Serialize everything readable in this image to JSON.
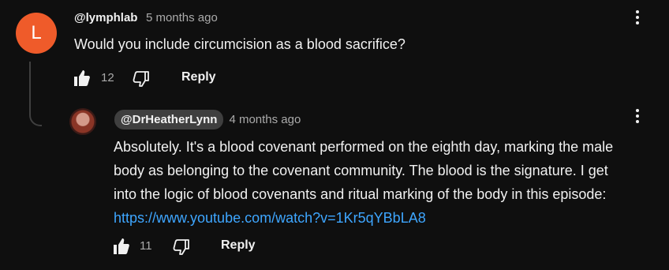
{
  "comment": {
    "avatar_letter": "L",
    "avatar_color": "#ef5b2a",
    "handle": "@lymphlab",
    "time": "5 months ago",
    "text": "Would you include circumcision as a blood sacrifice?",
    "likes": "12",
    "reply_label": "Reply"
  },
  "reply": {
    "handle": "@DrHeatherLynn",
    "time": "4 months ago",
    "lines": [
      "Absolutely. It's a blood covenant performed on the eighth day, marking the male",
      "body as belonging to the covenant community. The blood is the signature. I get",
      "into the logic of blood covenants and ritual marking of the body in this episode:"
    ],
    "link": "https://www.youtube.com/watch?v=1Kr5qYBbLA8",
    "likes": "11",
    "reply_label": "Reply"
  },
  "colors": {
    "background": "#0f0f0f",
    "link": "#3ea6ff",
    "muted": "#aaaaaa"
  },
  "icons": [
    "thumbs-up-icon",
    "thumbs-down-icon",
    "more-vert-icon"
  ]
}
